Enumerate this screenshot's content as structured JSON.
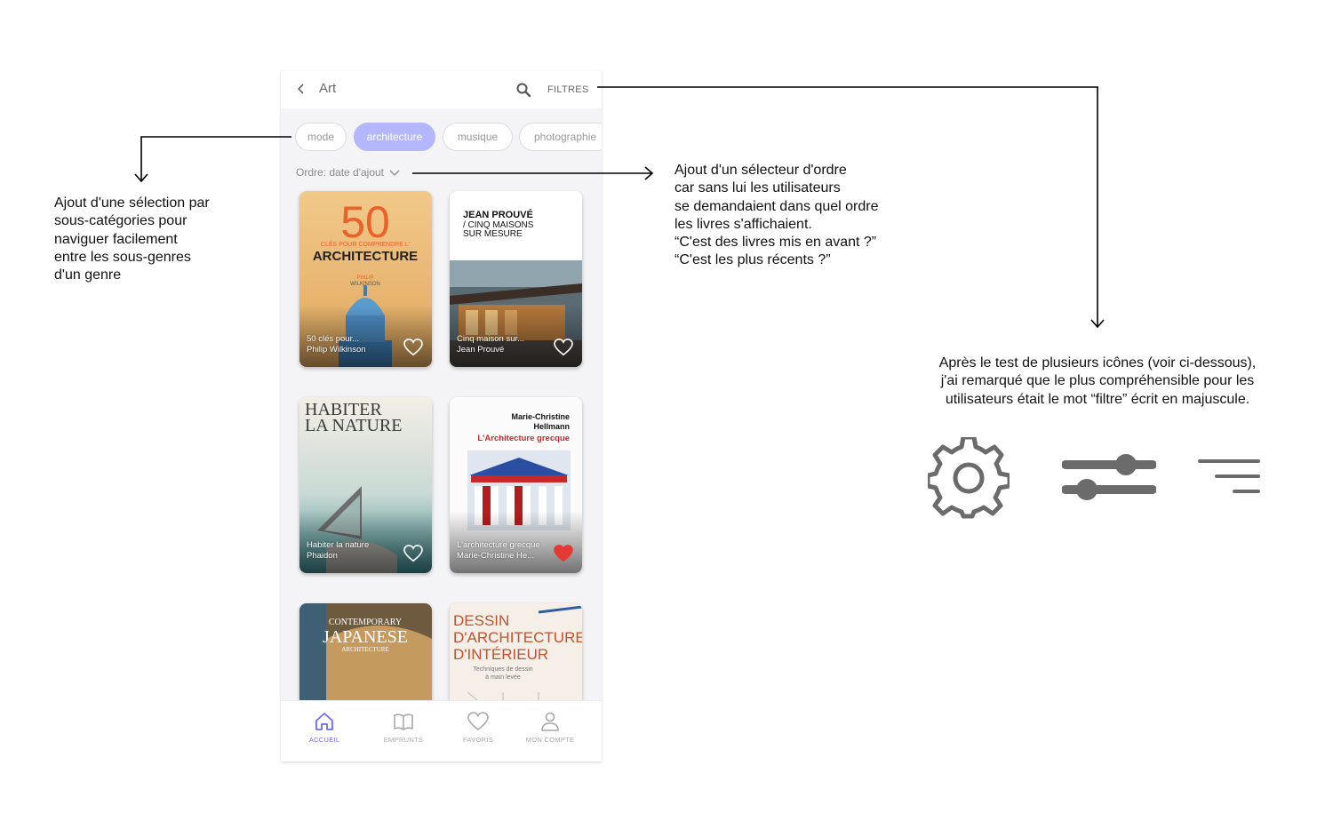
{
  "app": {
    "title": "Art",
    "filters_label": "FILTRES",
    "chips": [
      {
        "label": "mode",
        "active": false
      },
      {
        "label": "architecture",
        "active": true
      },
      {
        "label": "musique",
        "active": false
      },
      {
        "label": "photographie",
        "active": false
      }
    ],
    "order_label": "Ordre: date d'ajout",
    "books": [
      {
        "title": "50 clés pour...",
        "author": "Philip Wilkinson",
        "favorite": false,
        "cover": {
          "line1": "50",
          "line2": "CLÉS POUR COMPRENDRE L'",
          "line3": "ARCHITECTURE",
          "line4": "PHILIP",
          "line5": "WILKINSON"
        }
      },
      {
        "title": "Cinq maison sur...",
        "author": "Jean Prouvé",
        "favorite": false,
        "cover": {
          "line1": "JEAN PROUVÉ",
          "line2": "/ CINQ MAISONS",
          "line3": "SUR MESURE"
        }
      },
      {
        "title": "Habiter la nature",
        "author": "Phaidon",
        "favorite": false,
        "cover": {
          "line1": "HABITER",
          "line2": "LA NATURE"
        }
      },
      {
        "title": "L'architecture grecque",
        "author": "Marie-Christine He...",
        "favorite": true,
        "cover": {
          "line1": "Marie-Christine",
          "line2": "Hellmann",
          "line3": "L'Architecture grecque"
        }
      },
      {
        "title": "",
        "author": "",
        "favorite": false,
        "cover": {
          "line1": "CONTEMPORARY",
          "line2": "JAPANESE",
          "line3": "ARCHITECTURE"
        }
      },
      {
        "title": "",
        "author": "",
        "favorite": false,
        "cover": {
          "line1": "DESSIN",
          "line2": "D'ARCHITECTURE",
          "line3": "D'INTÉRIEUR",
          "line4": "Techniques de dessin",
          "line5": "à main levée"
        }
      }
    ],
    "nav": [
      {
        "label": "ACCUEIL",
        "icon": "home-icon",
        "active": true
      },
      {
        "label": "EMPRUNTS",
        "icon": "book-icon",
        "active": false
      },
      {
        "label": "FAVORIS",
        "icon": "heart-icon",
        "active": false
      },
      {
        "label": "MON COMPTE",
        "icon": "user-icon",
        "active": false
      }
    ]
  },
  "annotations": {
    "subcategories": [
      "Ajout d'une sélection par",
      "sous-catégories pour",
      "naviguer facilement",
      "entre les sous-genres",
      "d'un genre"
    ],
    "order": [
      "Ajout d'un sélecteur d'ordre",
      "car sans lui les utilisateurs",
      "se demandaient dans quel ordre",
      "les livres s'affichaient.",
      "“C'est des livres mis en avant ?”",
      "“C'est les plus récents ?”"
    ],
    "filters": [
      "Après le test de plusieurs icônes (voir ci-dessous),",
      "j'ai remarqué que le plus compréhensible pour les",
      "utilisateurs était le mot “filtre” écrit en majuscule."
    ]
  },
  "icon_examples": [
    "gear-icon",
    "sliders-icon",
    "filter-lines-icon"
  ],
  "colors": {
    "accent": "#b4b6ff",
    "nav_active": "#6c6cf0",
    "favorite": "#e53935",
    "demo_icon": "#6b6b6b"
  }
}
